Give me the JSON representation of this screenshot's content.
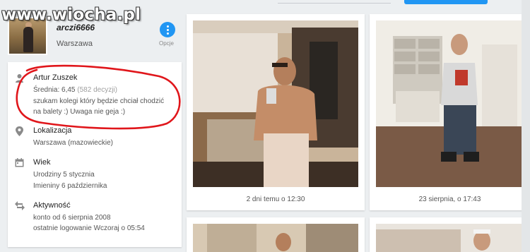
{
  "watermark": "www.wiocha.pl",
  "profile": {
    "username": "arczi6666",
    "city": "Warszawa",
    "options_label": "Opcje"
  },
  "info": {
    "name": "Artur Zuszek",
    "rating_prefix": "Średnia: 6,45",
    "rating_count": "(582 decyzji)",
    "bio_line1": "szukam kolegi który będzie chciał chodzić",
    "bio_line2": "na balety :) Uwaga nie geja :)",
    "location_title": "Lokalizacja",
    "location_value": "Warszawa (mazowieckie)",
    "age_title": "Wiek",
    "birthday": "Urodziny 5 stycznia",
    "nameday": "Imieniny 6 października",
    "activity_title": "Aktywność",
    "account_since": "konto od 6 sierpnia 2008",
    "last_login": "ostatnie logowanie Wczoraj o 05:54"
  },
  "photos": [
    {
      "caption": "2 dni temu o 12:30"
    },
    {
      "caption": "23 sierpnia, o 17:43"
    }
  ],
  "icons": {
    "person": "person-icon",
    "location": "location-pin-icon",
    "calendar": "calendar-icon",
    "activity": "swap-arrows-icon",
    "options": "more-vertical-icon"
  },
  "colors": {
    "accent": "#2196f3",
    "annotation": "#e0161b",
    "background": "#eceff1"
  }
}
